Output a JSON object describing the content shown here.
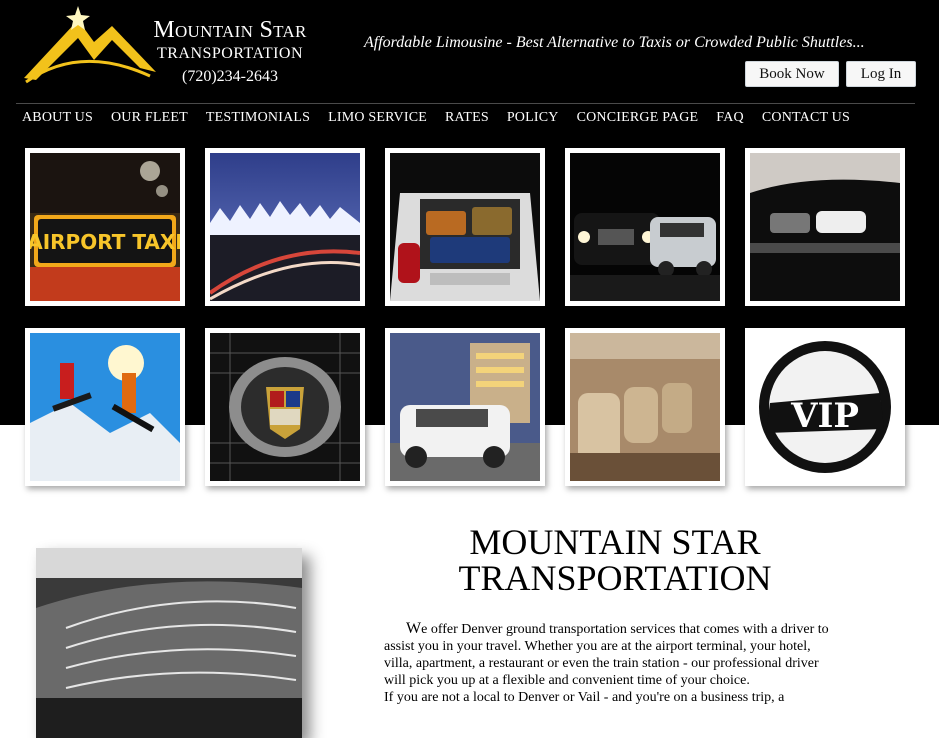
{
  "header": {
    "brand_name": "Mountain Star",
    "brand_sub": "TRANSPORTATION",
    "phone": "(720)234-2643",
    "tagline": "Affordable Limousine - Best Alternative to Taxis or Crowded Public Shuttles...",
    "book_now_label": "Book Now",
    "login_label": "Log In",
    "logo_icon": "mountain-star-logo"
  },
  "nav": {
    "items": [
      "ABOUT US",
      "OUR FLEET",
      "TESTIMONIALS",
      "LIMO SERVICE",
      "RATES",
      "POLICY",
      "CONCIERGE PAGE",
      "FAQ",
      "CONTACT US"
    ]
  },
  "gallery": {
    "taxi_sign_text": "AIRPORT TAXI",
    "vip_text": "VIP"
  },
  "main": {
    "heading_line1": "MOUNTAIN STAR",
    "heading_line2": "TRANSPORTATION",
    "para_first_letter": "W",
    "para_body": "e offer Denver ground transportation services that comes with a driver to assist you in your travel. Whether you are at the airport terminal, your hotel, villa, apartment, a restaurant or even the train station - our professional driver will pick you up at a flexible and convenient time of your choice.",
    "para_second": "If you are not a local to Denver or Vail - and you're on a business trip, a"
  },
  "colors": {
    "background": "#000000",
    "text_light": "#ffffff",
    "logo_gold": "#f2c21b"
  }
}
